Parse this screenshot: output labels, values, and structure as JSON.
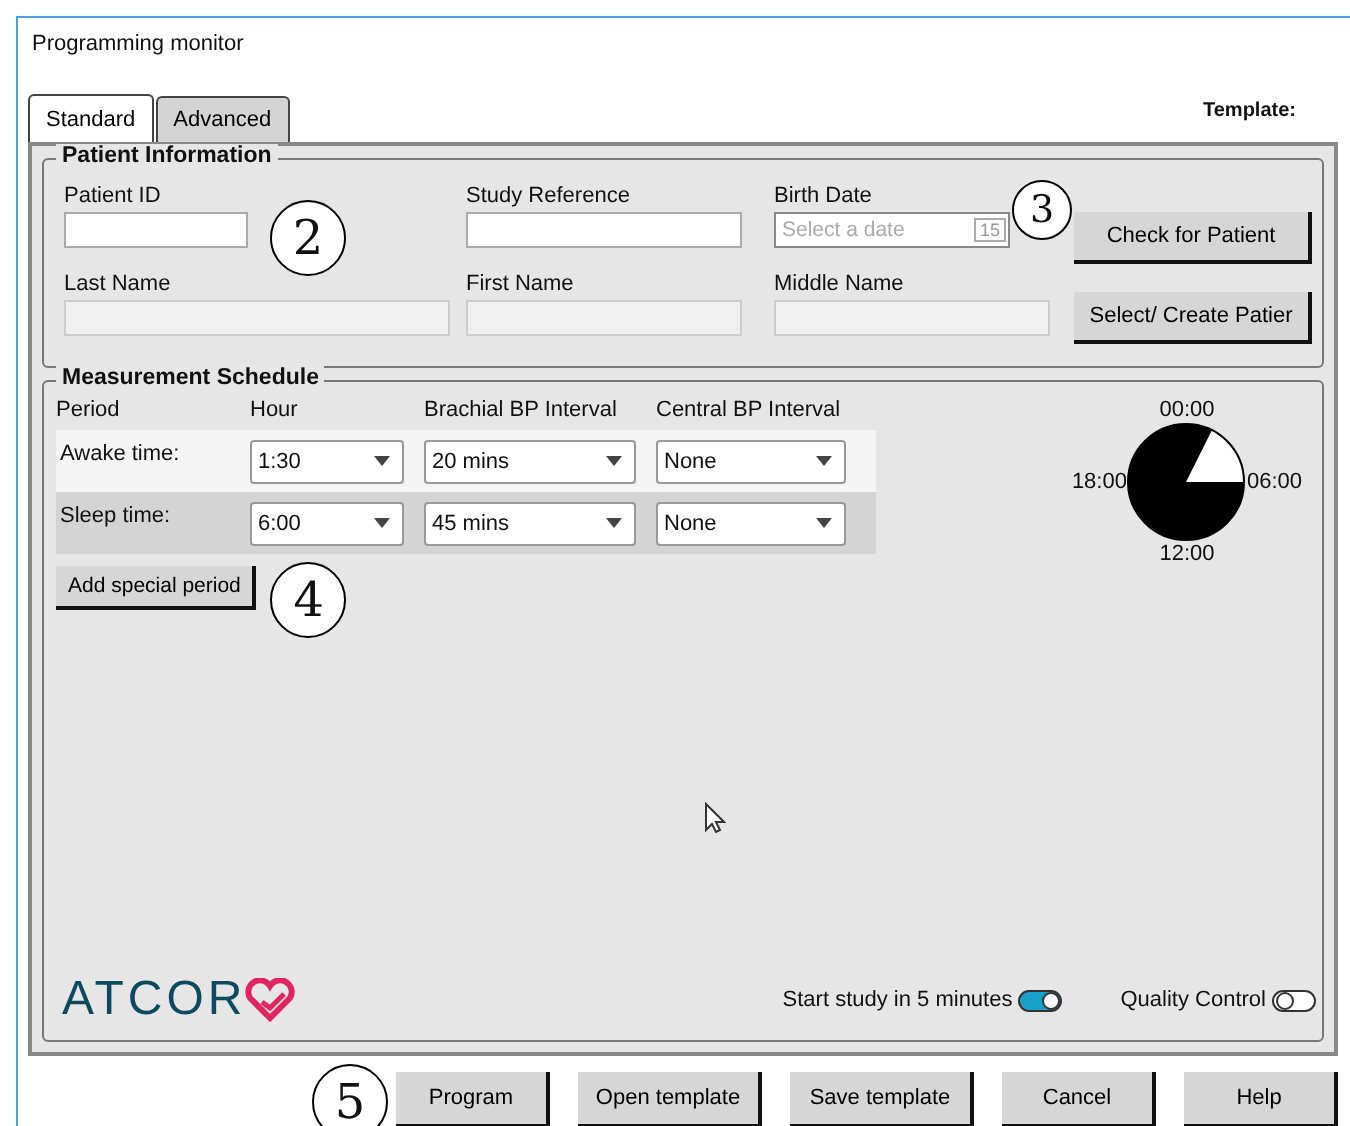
{
  "window": {
    "title": "Programming monitor"
  },
  "tabs": [
    {
      "label": "Standard",
      "selected": true
    },
    {
      "label": "Advanced",
      "selected": false
    }
  ],
  "template_label": "Template:",
  "patient": {
    "title": "Patient Information",
    "fields": [
      {
        "label": "Patient ID",
        "disabled": false
      },
      {
        "label": "Study Reference",
        "disabled": false
      },
      {
        "label": "Birth Date",
        "placeholder": "Select a date",
        "calendar": "15",
        "disabled": false
      },
      {
        "label": "Last Name",
        "disabled": true
      },
      {
        "label": "First Name",
        "disabled": true
      },
      {
        "label": "Middle Name",
        "disabled": true
      }
    ],
    "buttons": [
      "Check for Patient",
      "Select/ Create Patier"
    ]
  },
  "schedule": {
    "title": "Measurement Schedule",
    "columns": [
      "Period",
      "Hour",
      "Brachial BP Interval",
      "Central BP Interval"
    ],
    "rows": [
      {
        "period": "Awake time:",
        "hour": "1:30",
        "brachial": "20 mins",
        "central": "None"
      },
      {
        "period": "Sleep time:",
        "hour": "6:00",
        "brachial": "45 mins",
        "central": "None"
      }
    ],
    "add_button": "Add special period",
    "clock_labels": [
      "00:00",
      "06:00",
      "12:00",
      "18:00"
    ]
  },
  "logo": "ATCOR",
  "toggles": [
    {
      "label": "Start study in 5 minutes",
      "on": true
    },
    {
      "label": "Quality Control",
      "on": false
    }
  ],
  "buttons": [
    "Program",
    "Open template",
    "Save template",
    "Cancel",
    "Help"
  ],
  "callouts": [
    "2",
    "3",
    "4",
    "5"
  ]
}
